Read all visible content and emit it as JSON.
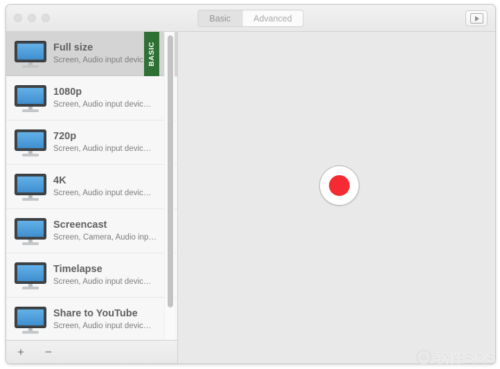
{
  "window": {
    "traffic_lights": [
      "close",
      "minimize",
      "zoom"
    ]
  },
  "toolbar": {
    "segments": [
      {
        "label": "Basic",
        "selected": true
      },
      {
        "label": "Advanced",
        "selected": false
      }
    ],
    "preview_button": "play-preview"
  },
  "sidebar": {
    "items": [
      {
        "title": "Full size",
        "subtitle": "Screen, Audio input devic…",
        "selected": true,
        "badge": "BASIC"
      },
      {
        "title": "1080p",
        "subtitle": "Screen, Audio input devic…",
        "selected": false,
        "badge": ""
      },
      {
        "title": "720p",
        "subtitle": "Screen, Audio input devic…",
        "selected": false,
        "badge": ""
      },
      {
        "title": "4K",
        "subtitle": "Screen, Audio input devic…",
        "selected": false,
        "badge": ""
      },
      {
        "title": "Screencast",
        "subtitle": "Screen, Camera, Audio inp…",
        "selected": false,
        "badge": ""
      },
      {
        "title": "Timelapse",
        "subtitle": "Screen, Audio input devic…",
        "selected": false,
        "badge": ""
      },
      {
        "title": "Share to YouTube",
        "subtitle": "Screen, Audio input devic…",
        "selected": false,
        "badge": ""
      }
    ],
    "footer": {
      "add_label": "+",
      "remove_label": "−"
    }
  },
  "main": {
    "record_button": "record"
  },
  "watermark": {
    "text": "软件SOS"
  },
  "colors": {
    "badge_green": "#2f7135",
    "record_red": "#f42b33",
    "screen_blue": "#4f9fdc",
    "selected_row": "#d4d4d4"
  }
}
